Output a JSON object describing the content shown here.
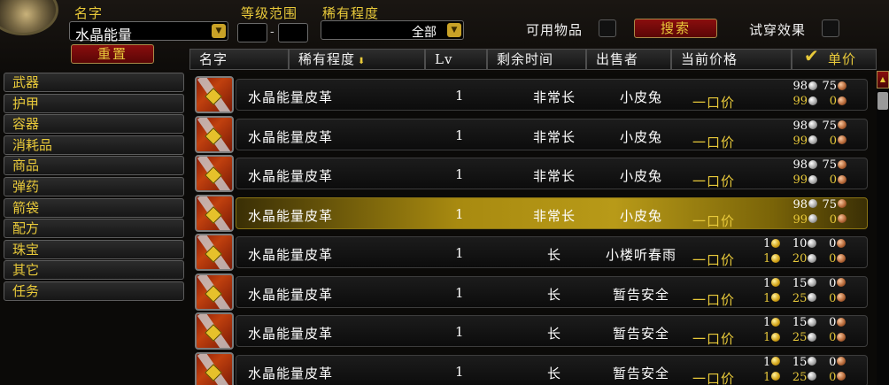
{
  "filters": {
    "name_label": "名字",
    "name_value": "水晶能量",
    "level_range_label": "等级范围",
    "level_min": "",
    "level_max": "",
    "level_dash": "-",
    "rarity_label": "稀有程度",
    "rarity_value": "全部",
    "usable_label": "可用物品",
    "search_button": "搜索",
    "try_on_label": "试穿效果",
    "reset_button": "重置"
  },
  "categories": [
    "武器",
    "护甲",
    "容器",
    "消耗品",
    "商品",
    "弹药",
    "箭袋",
    "配方",
    "珠宝",
    "其它",
    "任务"
  ],
  "columns": {
    "name": "名字",
    "rarity": "稀有程度",
    "level": "Lv",
    "time_left": "剩余时间",
    "seller": "出售者",
    "current_price": "当前价格",
    "unit_price": "单价"
  },
  "buyout_label": "一口价",
  "rows": [
    {
      "name": "水晶能量皮革",
      "level": "1",
      "time": "非常长",
      "seller": "小皮兔",
      "bid_g": "",
      "bid_s": "98",
      "bid_c": "75",
      "buy_g": "",
      "buy_s": "99",
      "buy_c": "0"
    },
    {
      "name": "水晶能量皮革",
      "level": "1",
      "time": "非常长",
      "seller": "小皮兔",
      "bid_g": "",
      "bid_s": "98",
      "bid_c": "75",
      "buy_g": "",
      "buy_s": "99",
      "buy_c": "0"
    },
    {
      "name": "水晶能量皮革",
      "level": "1",
      "time": "非常长",
      "seller": "小皮兔",
      "bid_g": "",
      "bid_s": "98",
      "bid_c": "75",
      "buy_g": "",
      "buy_s": "99",
      "buy_c": "0"
    },
    {
      "name": "水晶能量皮革",
      "level": "1",
      "time": "非常长",
      "seller": "小皮兔",
      "bid_g": "",
      "bid_s": "98",
      "bid_c": "75",
      "buy_g": "",
      "buy_s": "99",
      "buy_c": "0"
    },
    {
      "name": "水晶能量皮革",
      "level": "1",
      "time": "长",
      "seller": "小楼听春雨",
      "bid_g": "1",
      "bid_s": "10",
      "bid_c": "0",
      "buy_g": "1",
      "buy_s": "20",
      "buy_c": "0"
    },
    {
      "name": "水晶能量皮革",
      "level": "1",
      "time": "长",
      "seller": "暂告安全",
      "bid_g": "1",
      "bid_s": "15",
      "bid_c": "0",
      "buy_g": "1",
      "buy_s": "25",
      "buy_c": "0"
    },
    {
      "name": "水晶能量皮革",
      "level": "1",
      "time": "长",
      "seller": "暂告安全",
      "bid_g": "1",
      "bid_s": "15",
      "bid_c": "0",
      "buy_g": "1",
      "buy_s": "25",
      "buy_c": "0"
    },
    {
      "name": "水晶能量皮革",
      "level": "1",
      "time": "长",
      "seller": "暂告安全",
      "bid_g": "1",
      "bid_s": "15",
      "bid_c": "0",
      "buy_g": "1",
      "buy_s": "25",
      "buy_c": "0"
    }
  ],
  "selected_row": 3,
  "colors": {
    "gold_text": "#e8c93a",
    "selection": "#b89a18",
    "button_red": "#8a0e0e"
  }
}
